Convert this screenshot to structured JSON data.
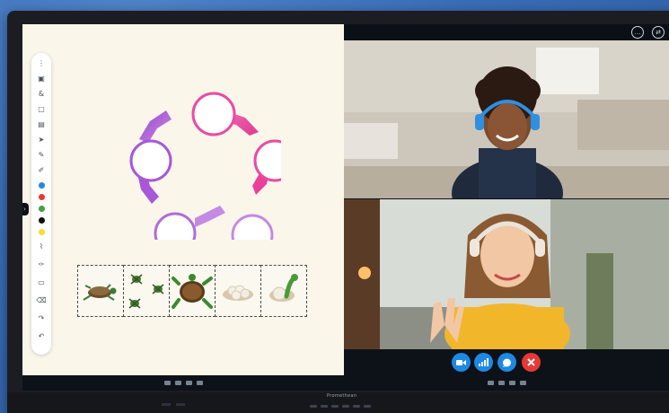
{
  "device": {
    "brand_label": "Promethean",
    "handle_glyph": "›"
  },
  "whiteboard": {
    "toolbar": {
      "tools": [
        {
          "icon": "more-vertical-icon",
          "glyph": "⋮"
        },
        {
          "icon": "save-icon",
          "glyph": "▣"
        },
        {
          "icon": "text-recognition-icon",
          "glyph": "&"
        },
        {
          "icon": "image-icon",
          "glyph": "▢"
        },
        {
          "icon": "pages-icon",
          "glyph": "▤"
        },
        {
          "icon": "select-pointer-icon",
          "glyph": "➤"
        },
        {
          "icon": "pen-icon",
          "glyph": "✎"
        },
        {
          "icon": "marker-icon",
          "glyph": "✐"
        }
      ],
      "pen_colors": [
        "#1e88e5",
        "#e53935",
        "#43a047",
        "#111111",
        "#fdd835"
      ],
      "tools_bottom": [
        {
          "icon": "highlighter-icon",
          "glyph": "⌇"
        },
        {
          "icon": "eraser-icon",
          "glyph": "✑"
        },
        {
          "icon": "sticky-note-icon",
          "glyph": "▭"
        },
        {
          "icon": "delete-icon",
          "glyph": "⌫"
        },
        {
          "icon": "redo-icon",
          "glyph": "↷"
        },
        {
          "icon": "undo-icon",
          "glyph": "↶"
        }
      ]
    },
    "cycle_colors": {
      "arrow_pink": "#ec4fa8",
      "arrow_purple": "#a24fd1",
      "arrow_lilac": "#c48ae3",
      "node_border_pink": "#e94ba3",
      "node_border_purple": "#b06cd6"
    },
    "cards": [
      {
        "label": "turtle-hatchling-card"
      },
      {
        "label": "baby-turtles-card"
      },
      {
        "label": "adult-turtle-card"
      },
      {
        "label": "eggs-card"
      },
      {
        "label": "hatching-egg-card"
      }
    ]
  },
  "video_call": {
    "top_buttons": [
      {
        "icon": "more-options-icon",
        "glyph": "…"
      },
      {
        "icon": "swap-layout-icon",
        "glyph": "⇄"
      }
    ],
    "controls": [
      {
        "icon": "camera-icon",
        "color": "#1e88e5"
      },
      {
        "icon": "signal-bars-icon",
        "color": "#1e88e5"
      },
      {
        "icon": "chat-bubble-icon",
        "color": "#1e88e5"
      },
      {
        "icon": "end-call-icon",
        "color": "#e53935"
      }
    ]
  }
}
